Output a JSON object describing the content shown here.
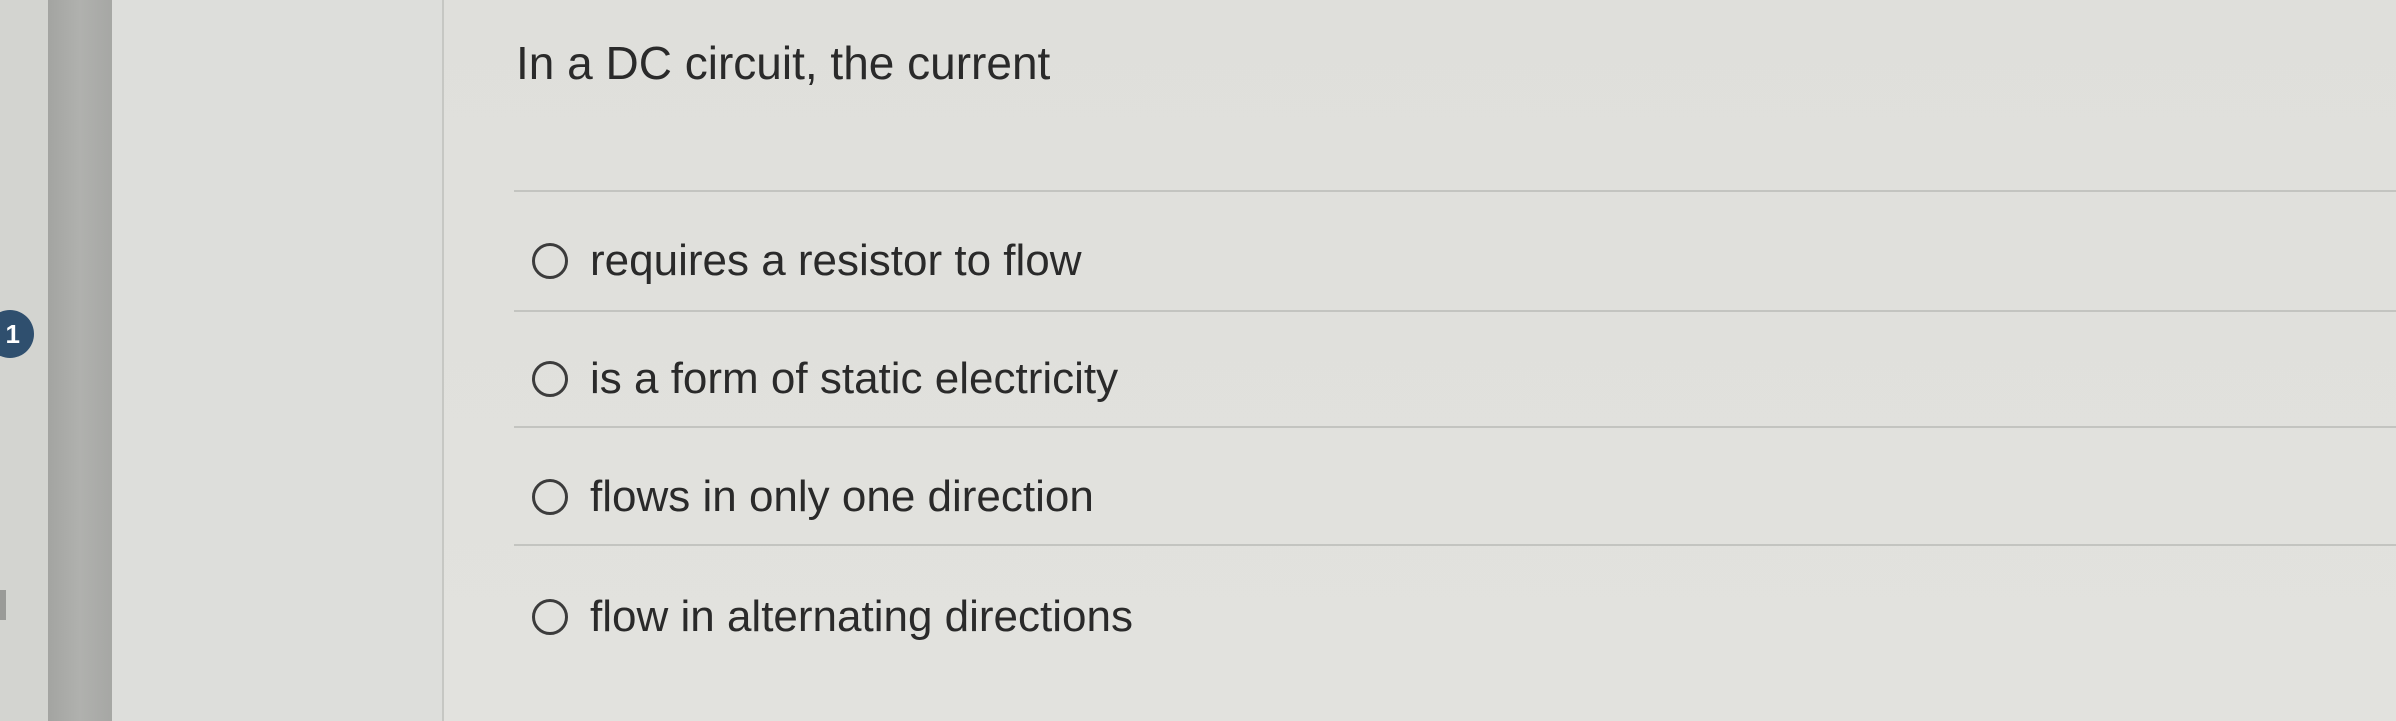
{
  "question": {
    "number": "1",
    "text": "In a DC circuit, the current"
  },
  "options": [
    {
      "label": "requires a resistor to flow",
      "selected": false
    },
    {
      "label": "is a form of static electricity",
      "selected": false
    },
    {
      "label": "flows in only one direction",
      "selected": false
    },
    {
      "label": "flow in alternating directions",
      "selected": false
    }
  ],
  "colors": {
    "badge": "#2f4f6e",
    "background": "#dfdfdb",
    "text": "#2a2a2a"
  }
}
